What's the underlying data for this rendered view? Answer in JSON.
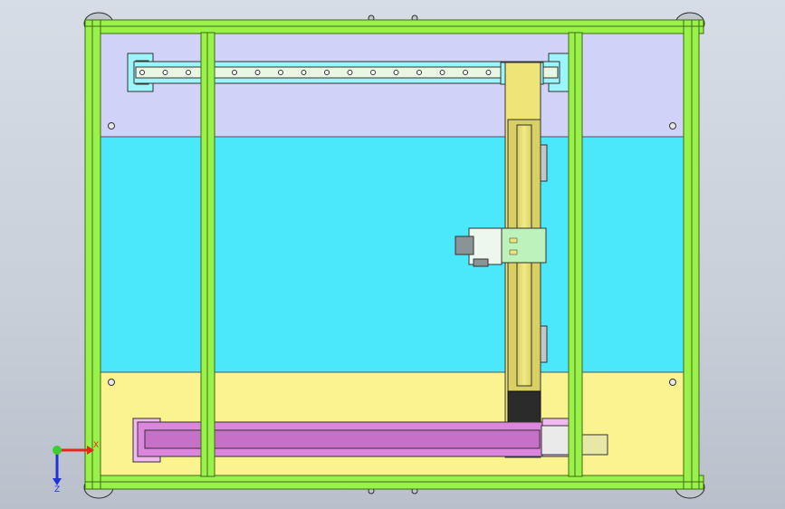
{
  "viewport": {
    "background_top": "#d7dde6",
    "background_bottom": "#b9c0cb"
  },
  "colors": {
    "frame_green": "#99f24a",
    "frame_edge": "#3e6a12",
    "panel_lavender": "#d0d3f7",
    "panel_cyan": "#4be8fb",
    "panel_yellow": "#fbf38f",
    "rail_cyan": "#9cf5fb",
    "module_yellow": "#efe477",
    "module_pink": "#dd86dd",
    "carriage_green": "#bdf2bd",
    "axis_x": "#e8251f",
    "axis_y": "#3ccf2d",
    "axis_z": "#2232d6"
  },
  "triad": {
    "x_label": "X",
    "z_label": "Z",
    "x_icon": "x-axis-arrow-icon",
    "y_icon": "y-axis-origin-icon",
    "z_icon": "z-axis-arrow-icon"
  }
}
